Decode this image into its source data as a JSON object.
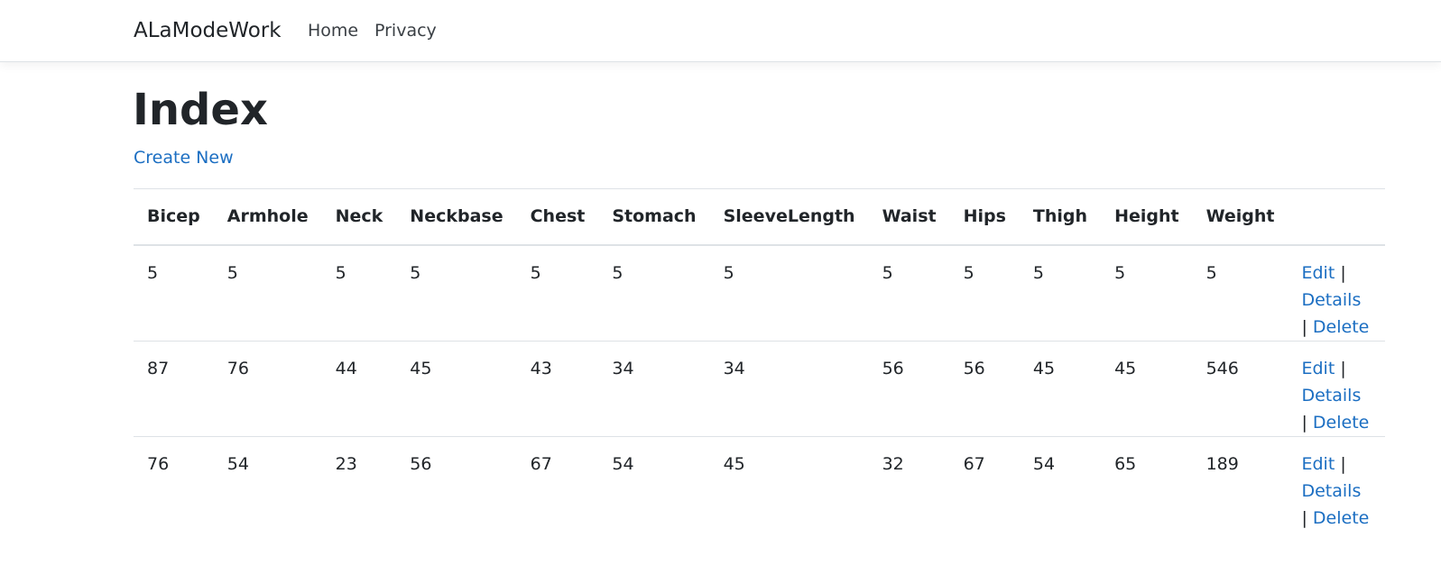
{
  "navbar": {
    "brand": "ALaModeWork",
    "links": [
      "Home",
      "Privacy"
    ]
  },
  "page": {
    "title": "Index",
    "create_link": "Create New"
  },
  "table": {
    "headers": [
      "Bicep",
      "Armhole",
      "Neck",
      "Neckbase",
      "Chest",
      "Stomach",
      "SleeveLength",
      "Waist",
      "Hips",
      "Thigh",
      "Height",
      "Weight"
    ],
    "rows": [
      [
        "5",
        "5",
        "5",
        "5",
        "5",
        "5",
        "5",
        "5",
        "5",
        "5",
        "5",
        "5"
      ],
      [
        "87",
        "76",
        "44",
        "45",
        "43",
        "34",
        "34",
        "56",
        "56",
        "45",
        "45",
        "546"
      ],
      [
        "76",
        "54",
        "23",
        "56",
        "67",
        "54",
        "45",
        "32",
        "67",
        "54",
        "65",
        "189"
      ]
    ],
    "actions": {
      "edit": "Edit",
      "details": "Details",
      "delete": "Delete",
      "separator": "|"
    }
  },
  "colors": {
    "link": "#1b6ec2",
    "text": "#212529",
    "border": "#dee2e6"
  }
}
